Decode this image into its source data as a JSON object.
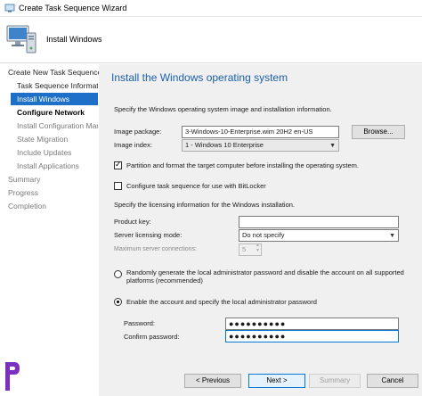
{
  "window": {
    "title": "Create Task Sequence Wizard"
  },
  "header": {
    "title": "Install Windows"
  },
  "sidebar": {
    "items": [
      {
        "label": "Create New Task Sequence"
      },
      {
        "label": "Task Sequence Informatio"
      },
      {
        "label": "Install Windows"
      },
      {
        "label": "Configure Network"
      },
      {
        "label": "Install Configuration Mar"
      },
      {
        "label": "State Migration"
      },
      {
        "label": "Include Updates"
      },
      {
        "label": "Install Applications"
      },
      {
        "label": "Summary"
      },
      {
        "label": "Progress"
      },
      {
        "label": "Completion"
      }
    ]
  },
  "main": {
    "heading": "Install the Windows operating system",
    "intro": "Specify the Windows operating system image and installation information.",
    "image_package_label": "Image package:",
    "image_package_value": "3-Windows-10-Enterprise.wim 20H2 en-US",
    "browse_label": "Browse...",
    "image_index_label": "Image index:",
    "image_index_value": "1 - Windows 10 Enterprise",
    "partition_label": "Partition and format the target computer before installing the operating system.",
    "partition_checked": true,
    "bitlocker_label": "Configure task sequence for use with BitLocker",
    "bitlocker_checked": false,
    "licensing_intro": "Specify the licensing information for the Windows installation.",
    "product_key_label": "Product key:",
    "product_key_value": "",
    "server_licensing_label": "Server licensing mode:",
    "server_licensing_value": "Do not specify",
    "max_connections_label": "Maximum server connections:",
    "max_connections_value": "5",
    "random_password_label_line1": "Randomly generate the local administrator password and disable the account on all supported",
    "random_password_label_line2": "platforms (recommended)",
    "enable_account_label": "Enable the account and specify the local administrator password",
    "password_label": "Password:",
    "password_value": "●●●●●●●●●●",
    "confirm_password_label": "Confirm password:",
    "confirm_password_value": "●●●●●●●●●●"
  },
  "footer": {
    "previous_label": "< Previous",
    "next_label": "Next >",
    "summary_label": "Summary",
    "cancel_label": "Cancel"
  },
  "colors": {
    "accent": "#1e6fc8",
    "heading": "#1b5fad",
    "panel": "#f0f0f0",
    "brand": "#7b2fbe"
  }
}
